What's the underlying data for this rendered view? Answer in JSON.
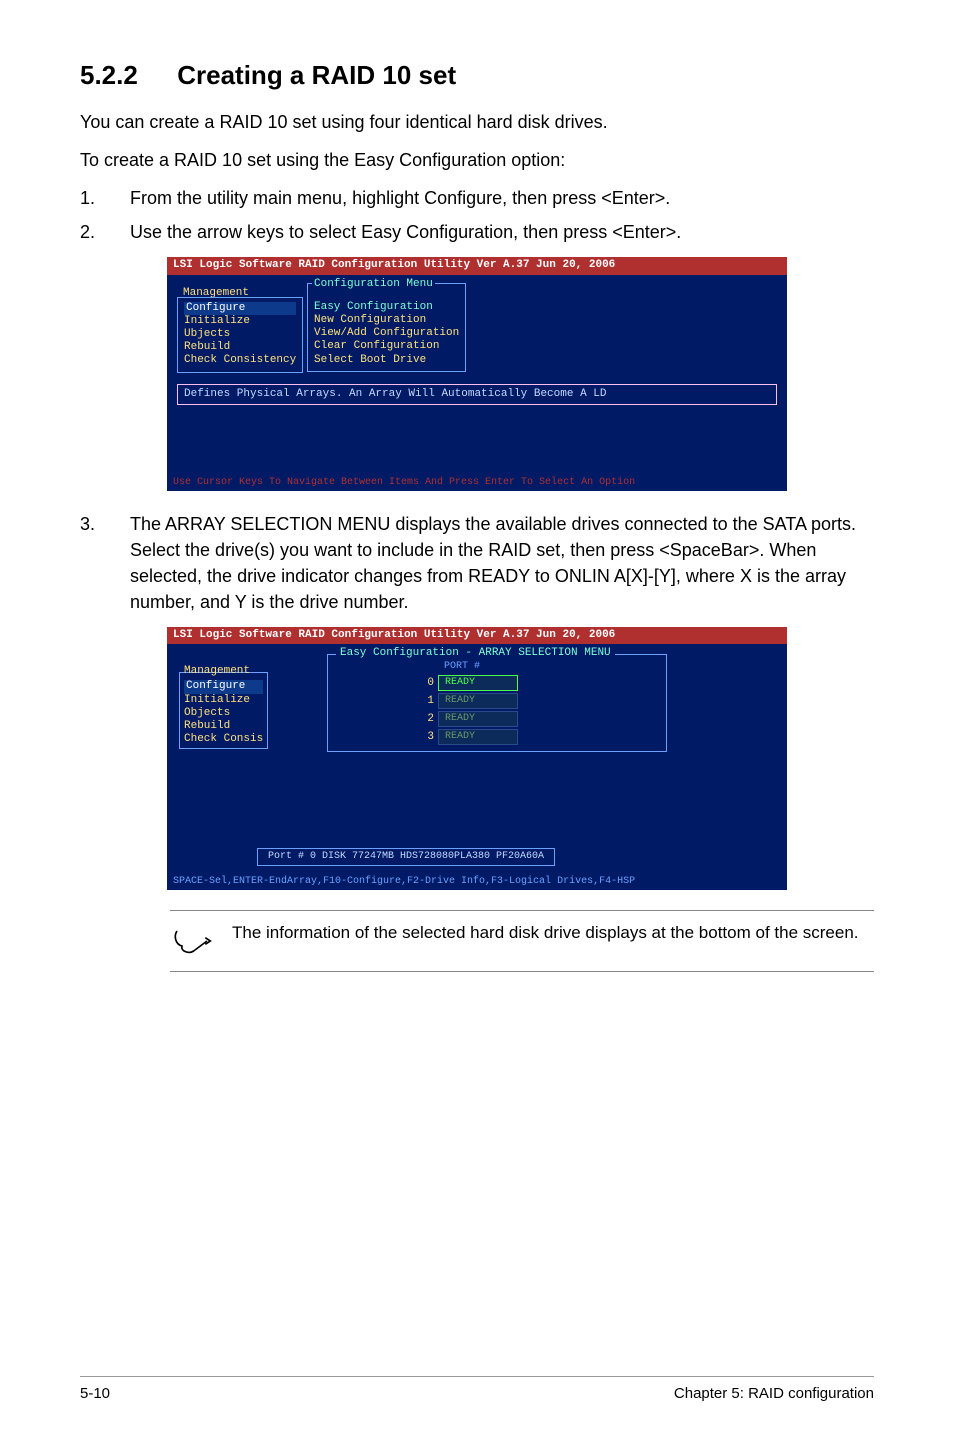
{
  "heading": {
    "number": "5.2.2",
    "title": "Creating a RAID 10 set"
  },
  "intro1": "You can create a RAID 10 set using four identical hard disk drives.",
  "intro2": "To create a RAID 10 set using the Easy Configuration option:",
  "steps": {
    "s1": {
      "num": "1.",
      "text": "From the utility main menu, highlight Configure, then press <Enter>."
    },
    "s2": {
      "num": "2.",
      "text": "Use the arrow keys to select Easy Configuration, then press <Enter>."
    },
    "s3": {
      "num": "3.",
      "text": "The ARRAY SELECTION MENU displays the available drives connected to the SATA ports. Select the drive(s) you want to include in the RAID set, then press <SpaceBar>. When selected, the drive indicator changes from READY  to ONLIN A[X]-[Y], where X is the array number, and Y is the drive number."
    }
  },
  "screenshot1": {
    "titlebar": "LSI Logic Software RAID Configuration Utility Ver A.37 Jun 20, 2006",
    "sidebar_label": "Management",
    "sidebar": {
      "i0": "Configure",
      "i1": "Initialize",
      "i2": "Ubjects",
      "i3": "Rebuild",
      "i4": "Check Consistency"
    },
    "config_title": "Configuration Menu",
    "config": {
      "i0": "Easy Configuration",
      "i1": "New Configuration",
      "i2": "View/Add Configuration",
      "i3": "Clear Configuration",
      "i4": "Select Boot Drive"
    },
    "status": "Defines Physical Arrays. An Array Will Automatically Become A LD",
    "bottom": "Use Cursor Keys To Navigate Between Items And Press Enter To Select An Option"
  },
  "screenshot2": {
    "titlebar": "LSI Logic Software RAID Configuration Utility Ver A.37 Jun 20, 2006",
    "sidebar_label": "Management",
    "sidebar": {
      "i0": "Configure",
      "i1": "Initialize",
      "i2": "Objects",
      "i3": "Rebuild",
      "i4": "Check Consis"
    },
    "array_title": "Easy Configuration - ARRAY SELECTION MENU",
    "port_head": "PORT #",
    "drives": {
      "d0": {
        "num": "0",
        "label": "READY"
      },
      "d1": {
        "num": "1",
        "label": "READY"
      },
      "d2": {
        "num": "2",
        "label": "READY"
      },
      "d3": {
        "num": "3",
        "label": "READY"
      }
    },
    "portinfo": "Port # 0 DISK  77247MB   HDS728080PLA380    PF20A60A",
    "bottom": "SPACE-Sel,ENTER-EndArray,F10-Configure,F2-Drive Info,F3-Logical Drives,F4-HSP"
  },
  "note": "The information of the selected hard disk drive displays at the bottom of the screen.",
  "footer": {
    "left": "5-10",
    "right": "Chapter 5: RAID configuration"
  }
}
